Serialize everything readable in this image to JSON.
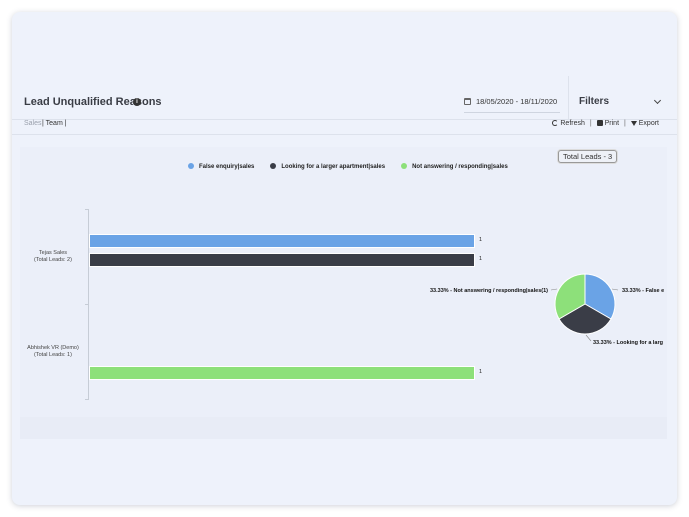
{
  "header": {
    "title": "Lead Unqualified Reasons",
    "info_icon": "i",
    "date_range": "18/05/2020 - 18/11/2020",
    "filters_label": "Filters"
  },
  "subnav": {
    "tabs": [
      "Sales",
      "Team"
    ],
    "separator": "|",
    "refresh_label": "Refresh",
    "print_label": "Print",
    "export_label": "Export"
  },
  "chart": {
    "total_leads_label": "Total Leads - 3"
  },
  "colors": {
    "false_enquiry": "#6aa3e6",
    "larger_apartment": "#3a3d47",
    "not_answering": "#8de07a"
  },
  "chart_data": [
    {
      "type": "bar",
      "orientation": "horizontal",
      "categories": [
        [
          "Tejas Sales",
          "(Total Leads: 2)"
        ],
        [
          "Abhishek VR (Demo)",
          "(Total Leads: 1)"
        ]
      ],
      "series": [
        {
          "name": "False enquiry|sales",
          "color": "#6aa3e6",
          "values": [
            1,
            0
          ]
        },
        {
          "name": "Looking for a larger apartment|sales",
          "color": "#3a3d47",
          "values": [
            1,
            0
          ]
        },
        {
          "name": "Not answering / responding|sales",
          "color": "#8de07a",
          "values": [
            0,
            1
          ]
        }
      ],
      "legend": "top",
      "grid": false
    },
    {
      "type": "pie",
      "slices": [
        {
          "label": "33.33% - False e",
          "value": 33.33,
          "color": "#6aa3e6"
        },
        {
          "label": "33.33% - Looking for a larg",
          "value": 33.33,
          "color": "#3a3d47"
        },
        {
          "label": "33.33% - Not answering / responding|sales(1)",
          "value": 33.33,
          "color": "#8de07a"
        }
      ]
    }
  ]
}
